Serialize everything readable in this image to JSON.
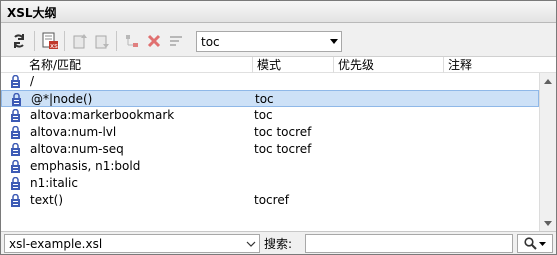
{
  "window": {
    "title": "XSL大纲"
  },
  "toolbar": {
    "buttons": [
      {
        "name": "refresh-icon"
      },
      {
        "name": "template-properties-icon"
      },
      {
        "name": "move-up-icon"
      },
      {
        "name": "move-down-icon"
      },
      {
        "name": "tree-icon"
      },
      {
        "name": "delete-icon"
      },
      {
        "name": "sort-icon"
      }
    ],
    "mode_select": {
      "value": "toc"
    }
  },
  "table": {
    "columns": [
      "名称/匹配",
      "模式",
      "优先级",
      "注释"
    ],
    "rows": [
      {
        "match": "/",
        "mode": ""
      },
      {
        "match": "@*|node()",
        "mode": "toc",
        "selected": true
      },
      {
        "match": "altova:markerbookmark",
        "mode": "toc"
      },
      {
        "match": "altova:num-lvl",
        "mode": "toc tocref"
      },
      {
        "match": "altova:num-seq",
        "mode": "toc tocref"
      },
      {
        "match": "emphasis, n1:bold",
        "mode": ""
      },
      {
        "match": "n1:italic",
        "mode": ""
      },
      {
        "match": "text()",
        "mode": "tocref"
      }
    ]
  },
  "footer": {
    "file": "xsl-example.xsl",
    "search_label": "搜索:",
    "search_value": ""
  },
  "colors": {
    "lock_icon": "#3d5bb5",
    "selection": "#cde1f7"
  }
}
